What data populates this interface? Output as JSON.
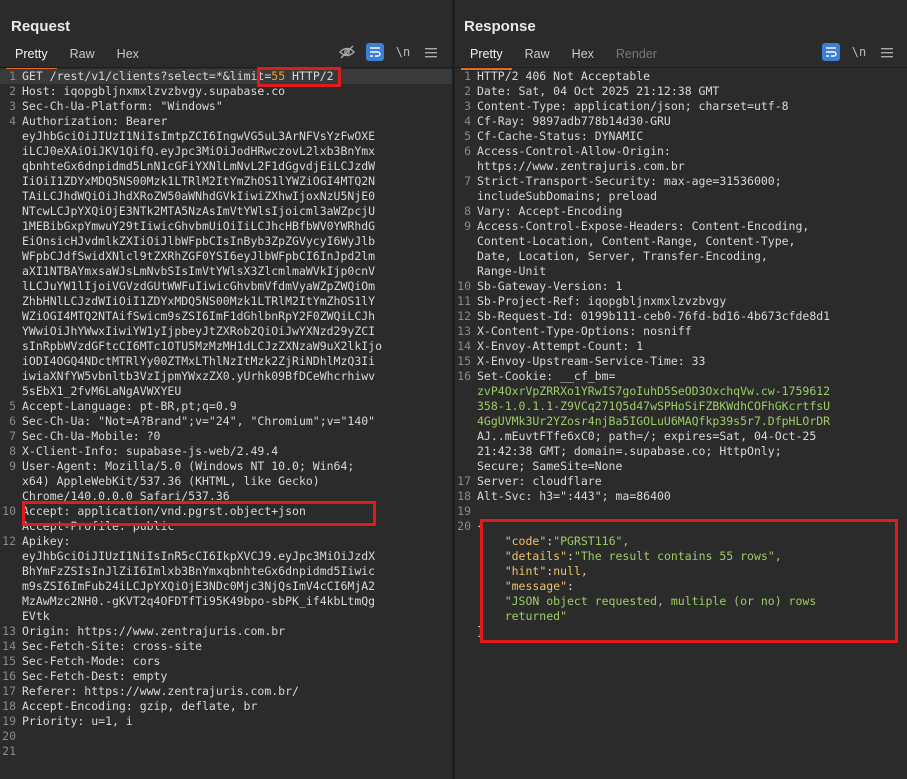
{
  "view_buttons": [
    "split-view-icon",
    "horizontal-view-icon",
    "single-view-icon"
  ],
  "request": {
    "title": "Request",
    "tabs": [
      "Pretty",
      "Raw",
      "Hex"
    ],
    "active_tab": "Pretty",
    "lines": [
      {
        "n": "1",
        "t": "GET /rest/v1/clients?select=*"
      },
      {
        "n": "2",
        "t": "Host: iqopgbljnxmxlzvzbvgy.supabase.co"
      },
      {
        "n": "3",
        "t": "Sec-Ch-Ua-Platform: \"Windows\""
      },
      {
        "n": "4",
        "t": "Authorization: Bearer"
      },
      {
        "n": "",
        "t": "eyJhbGciOiJIUzI1NiIsImtpZCI6IngwVG5uL3ArNFVsYzFwOXE"
      },
      {
        "n": "",
        "t": "iLCJ0eXAiOiJKV1QifQ.eyJpc3MiOiJodHRwczovL2lxb3BnYmx"
      },
      {
        "n": "",
        "t": "qbnhteGx6dnpidmd5LnN1cGFiYXNlLmNvL2F1dGgvdjEiLCJzdW"
      },
      {
        "n": "",
        "t": "IiOiI1ZDYxMDQ5NS00Mzk1LTRlM2ItYmZhOS1lYWZiOGI4MTQ2N"
      },
      {
        "n": "",
        "t": "TAiLCJhdWQiOiJhdXRoZW50aWNhdGVkIiwiZXhwIjoxNzU5NjE0"
      },
      {
        "n": "",
        "t": "NTcwLCJpYXQiOjE3NTk2MTA5NzAsImVtYWlsIjoicml3aWZpcjU"
      },
      {
        "n": "",
        "t": "1MEBibGxpYmwuY29tIiwicGhvbmUiOiIiLCJhcHBfbWV0YWRhdG"
      },
      {
        "n": "",
        "t": "EiOnsicHJvdmlkZXIiOiJlbWFpbCIsInByb3ZpZGVycyI6WyJlb"
      },
      {
        "n": "",
        "t": "WFpbCJdfSwidXNlcl9tZXRhZGF0YSI6eyJlbWFpbCI6InJpd2lm"
      },
      {
        "n": "",
        "t": "aXI1NTBAYmxsaWJsLmNvbSIsImVtYWlsX3ZlcmlmaWVkIjp0cnV"
      },
      {
        "n": "",
        "t": "lLCJuYW1lIjoiVGVzdGUtWWFuIiwicGhvbmVfdmVyaWZpZWQiOm"
      },
      {
        "n": "",
        "t": "ZhbHNlLCJzdWIiOiI1ZDYxMDQ5NS00Mzk1LTRlM2ItYmZhOS1lY"
      },
      {
        "n": "",
        "t": "WZiOGI4MTQ2NTAifSwicm9sZSI6ImF1dGhlbnRpY2F0ZWQiLCJh"
      },
      {
        "n": "",
        "t": "YWwiOiJhYWwxIiwiYW1yIjpbeyJtZXRob2QiOiJwYXNzd29yZCI"
      },
      {
        "n": "",
        "t": "sInRpbWVzdGFtcCI6MTc1OTU5MzMzMH1dLCJzZXNzaW9uX2lkIjo"
      },
      {
        "n": "",
        "t": "iODI4OGQ4NDctMTRlYy00ZTMxLThlNzItMzk2ZjRiNDhlMzQ3Ii"
      },
      {
        "n": "",
        "t": "iwiaXNfYW5vbnltb3VzIjpmYWxzZX0.yUrhk09BfDCeWhcrhiwv"
      },
      {
        "n": "",
        "t": "5sEbX1_2fvM6LaNgAVWXYEU"
      },
      {
        "n": "5",
        "t": "Accept-Language: pt-BR,pt;q=0.9"
      },
      {
        "n": "6",
        "t": "Sec-Ch-Ua: \"Not=A?Brand\";v=\"24\", \"Chromium\";v=\"140\""
      },
      {
        "n": "7",
        "t": "Sec-Ch-Ua-Mobile: ?0"
      },
      {
        "n": "8",
        "t": "X-Client-Info: supabase-js-web/2.49.4"
      },
      {
        "n": "9",
        "t": "User-Agent: Mozilla/5.0 (Windows NT 10.0; Win64;"
      },
      {
        "n": "",
        "t": "x64) AppleWebKit/537.36 (KHTML, like Gecko)"
      },
      {
        "n": "",
        "t": "Chrome/140.0.0.0 Safari/537.36"
      },
      {
        "n": "10",
        "t": "Accept: application/vnd.pgrst.object+json"
      },
      {
        "n": "",
        "t": "Accept-Profile: public"
      },
      {
        "n": "12",
        "t": "Apikey:"
      },
      {
        "n": "",
        "t": "eyJhbGciOiJIUzI1NiIsInR5cCI6IkpXVCJ9.eyJpc3MiOiJzdX"
      },
      {
        "n": "",
        "t": "BhYmFzZSIsInJlZiI6Imlxb3BnYmxqbnhteGx6dnpidmd5Iiwic"
      },
      {
        "n": "",
        "t": "m9sZSI6ImFub24iLCJpYXQiOjE3NDc0Mjc3NjQsImV4cCI6MjA2"
      },
      {
        "n": "",
        "t": "MzAwMzc2NH0.-gKVT2q4OFDTfTi95K49bpo-sbPK_if4kbLtmQg"
      },
      {
        "n": "",
        "t": "EVtk"
      },
      {
        "n": "13",
        "t": "Origin: https://www.zentrajuris.com.br"
      },
      {
        "n": "14",
        "t": "Sec-Fetch-Site: cross-site"
      },
      {
        "n": "15",
        "t": "Sec-Fetch-Mode: cors"
      },
      {
        "n": "16",
        "t": "Sec-Fetch-Dest: empty"
      },
      {
        "n": "17",
        "t": "Referer: https://www.zentrajuris.com.br/"
      },
      {
        "n": "18",
        "t": "Accept-Encoding: gzip, deflate, br"
      },
      {
        "n": "19",
        "t": "Priority: u=1, i"
      },
      {
        "n": "20",
        "t": ""
      },
      {
        "n": "21",
        "t": ""
      }
    ],
    "limit_param": "&limit=55",
    "limit_key": "&limit=",
    "limit_value": "55",
    "line1_suffix": " HTTP/2"
  },
  "response": {
    "title": "Response",
    "tabs": [
      "Pretty",
      "Raw",
      "Hex",
      "Render"
    ],
    "active_tab": "Pretty",
    "lines": [
      {
        "n": "1",
        "t": "HTTP/2 406 Not Acceptable"
      },
      {
        "n": "2",
        "t": "Date: Sat, 04 Oct 2025 21:12:38 GMT"
      },
      {
        "n": "3",
        "t": "Content-Type: application/json; charset=utf-8"
      },
      {
        "n": "4",
        "t": "Cf-Ray: 9897adb778b14d30-GRU"
      },
      {
        "n": "5",
        "t": "Cf-Cache-Status: DYNAMIC"
      },
      {
        "n": "6",
        "t": "Access-Control-Allow-Origin:"
      },
      {
        "n": "",
        "t": "https://www.zentrajuris.com.br"
      },
      {
        "n": "7",
        "t": "Strict-Transport-Security: max-age=31536000;"
      },
      {
        "n": "",
        "t": "includeSubDomains; preload"
      },
      {
        "n": "8",
        "t": "Vary: Accept-Encoding"
      },
      {
        "n": "9",
        "t": "Access-Control-Expose-Headers: Content-Encoding,"
      },
      {
        "n": "",
        "t": "Content-Location, Content-Range, Content-Type,"
      },
      {
        "n": "",
        "t": "Date, Location, Server, Transfer-Encoding,"
      },
      {
        "n": "",
        "t": "Range-Unit"
      },
      {
        "n": "10",
        "t": "Sb-Gateway-Version: 1"
      },
      {
        "n": "11",
        "t": "Sb-Project-Ref: iqopgbljnxmxlzvzbvgy"
      },
      {
        "n": "12",
        "t": "Sb-Request-Id: 0199b111-ceb0-76fd-bd16-4b673cfde8d1"
      },
      {
        "n": "13",
        "t": "X-Content-Type-Options: nosniff"
      },
      {
        "n": "14",
        "t": "X-Envoy-Attempt-Count: 1"
      },
      {
        "n": "15",
        "t": "X-Envoy-Upstream-Service-Time: 33"
      },
      {
        "n": "16",
        "t": "Set-Cookie: __cf_bm="
      },
      {
        "n": "",
        "t": "zvP4OxrVpZRRXo1YRwIS7goIuhD5SeOD3OxchqVw.cw-1759612",
        "c": "s-str"
      },
      {
        "n": "",
        "t": "358-1.0.1.1-Z9VCq271Q5d47wSPHoSiFZBKWdhCOFhGKcrtfsU",
        "c": "s-str"
      },
      {
        "n": "",
        "t": "4GgUVMk3Ur2YZosr4njBa5IGOLuU6MAQfkp39s5r7.DfpHLOrDR",
        "c": "s-str"
      },
      {
        "n": "",
        "t": "AJ..mEuvtFTfe6xC0; path=/; expires=Sat, 04-Oct-25"
      },
      {
        "n": "",
        "t": "21:42:38 GMT; domain=.supabase.co; HttpOnly;"
      },
      {
        "n": "",
        "t": "Secure; SameSite=None"
      },
      {
        "n": "17",
        "t": "Server: cloudflare"
      },
      {
        "n": "18",
        "t": "Alt-Svc: h3=\":443\"; ma=86400"
      },
      {
        "n": "19",
        "t": ""
      },
      {
        "n": "20",
        "t": "{"
      },
      {
        "n": "",
        "t": "    \"code\":\"PGRST116\",",
        "j": true
      },
      {
        "n": "",
        "t": "    \"details\":\"The result contains 55 rows\",",
        "j": true
      },
      {
        "n": "",
        "t": "    \"hint\":null,",
        "j": true
      },
      {
        "n": "",
        "t": "    \"message\":",
        "j": true
      },
      {
        "n": "",
        "t": "    \"JSON object requested, multiple (or no) rows",
        "c": "s-str"
      },
      {
        "n": "",
        "t": "    returned\"",
        "c": "s-str"
      },
      {
        "n": "",
        "t": "}"
      }
    ]
  },
  "colors": {
    "accent": "#3c7fd6",
    "tab_underline": "#e06c2a",
    "highlight_box": "#e01b1b"
  }
}
